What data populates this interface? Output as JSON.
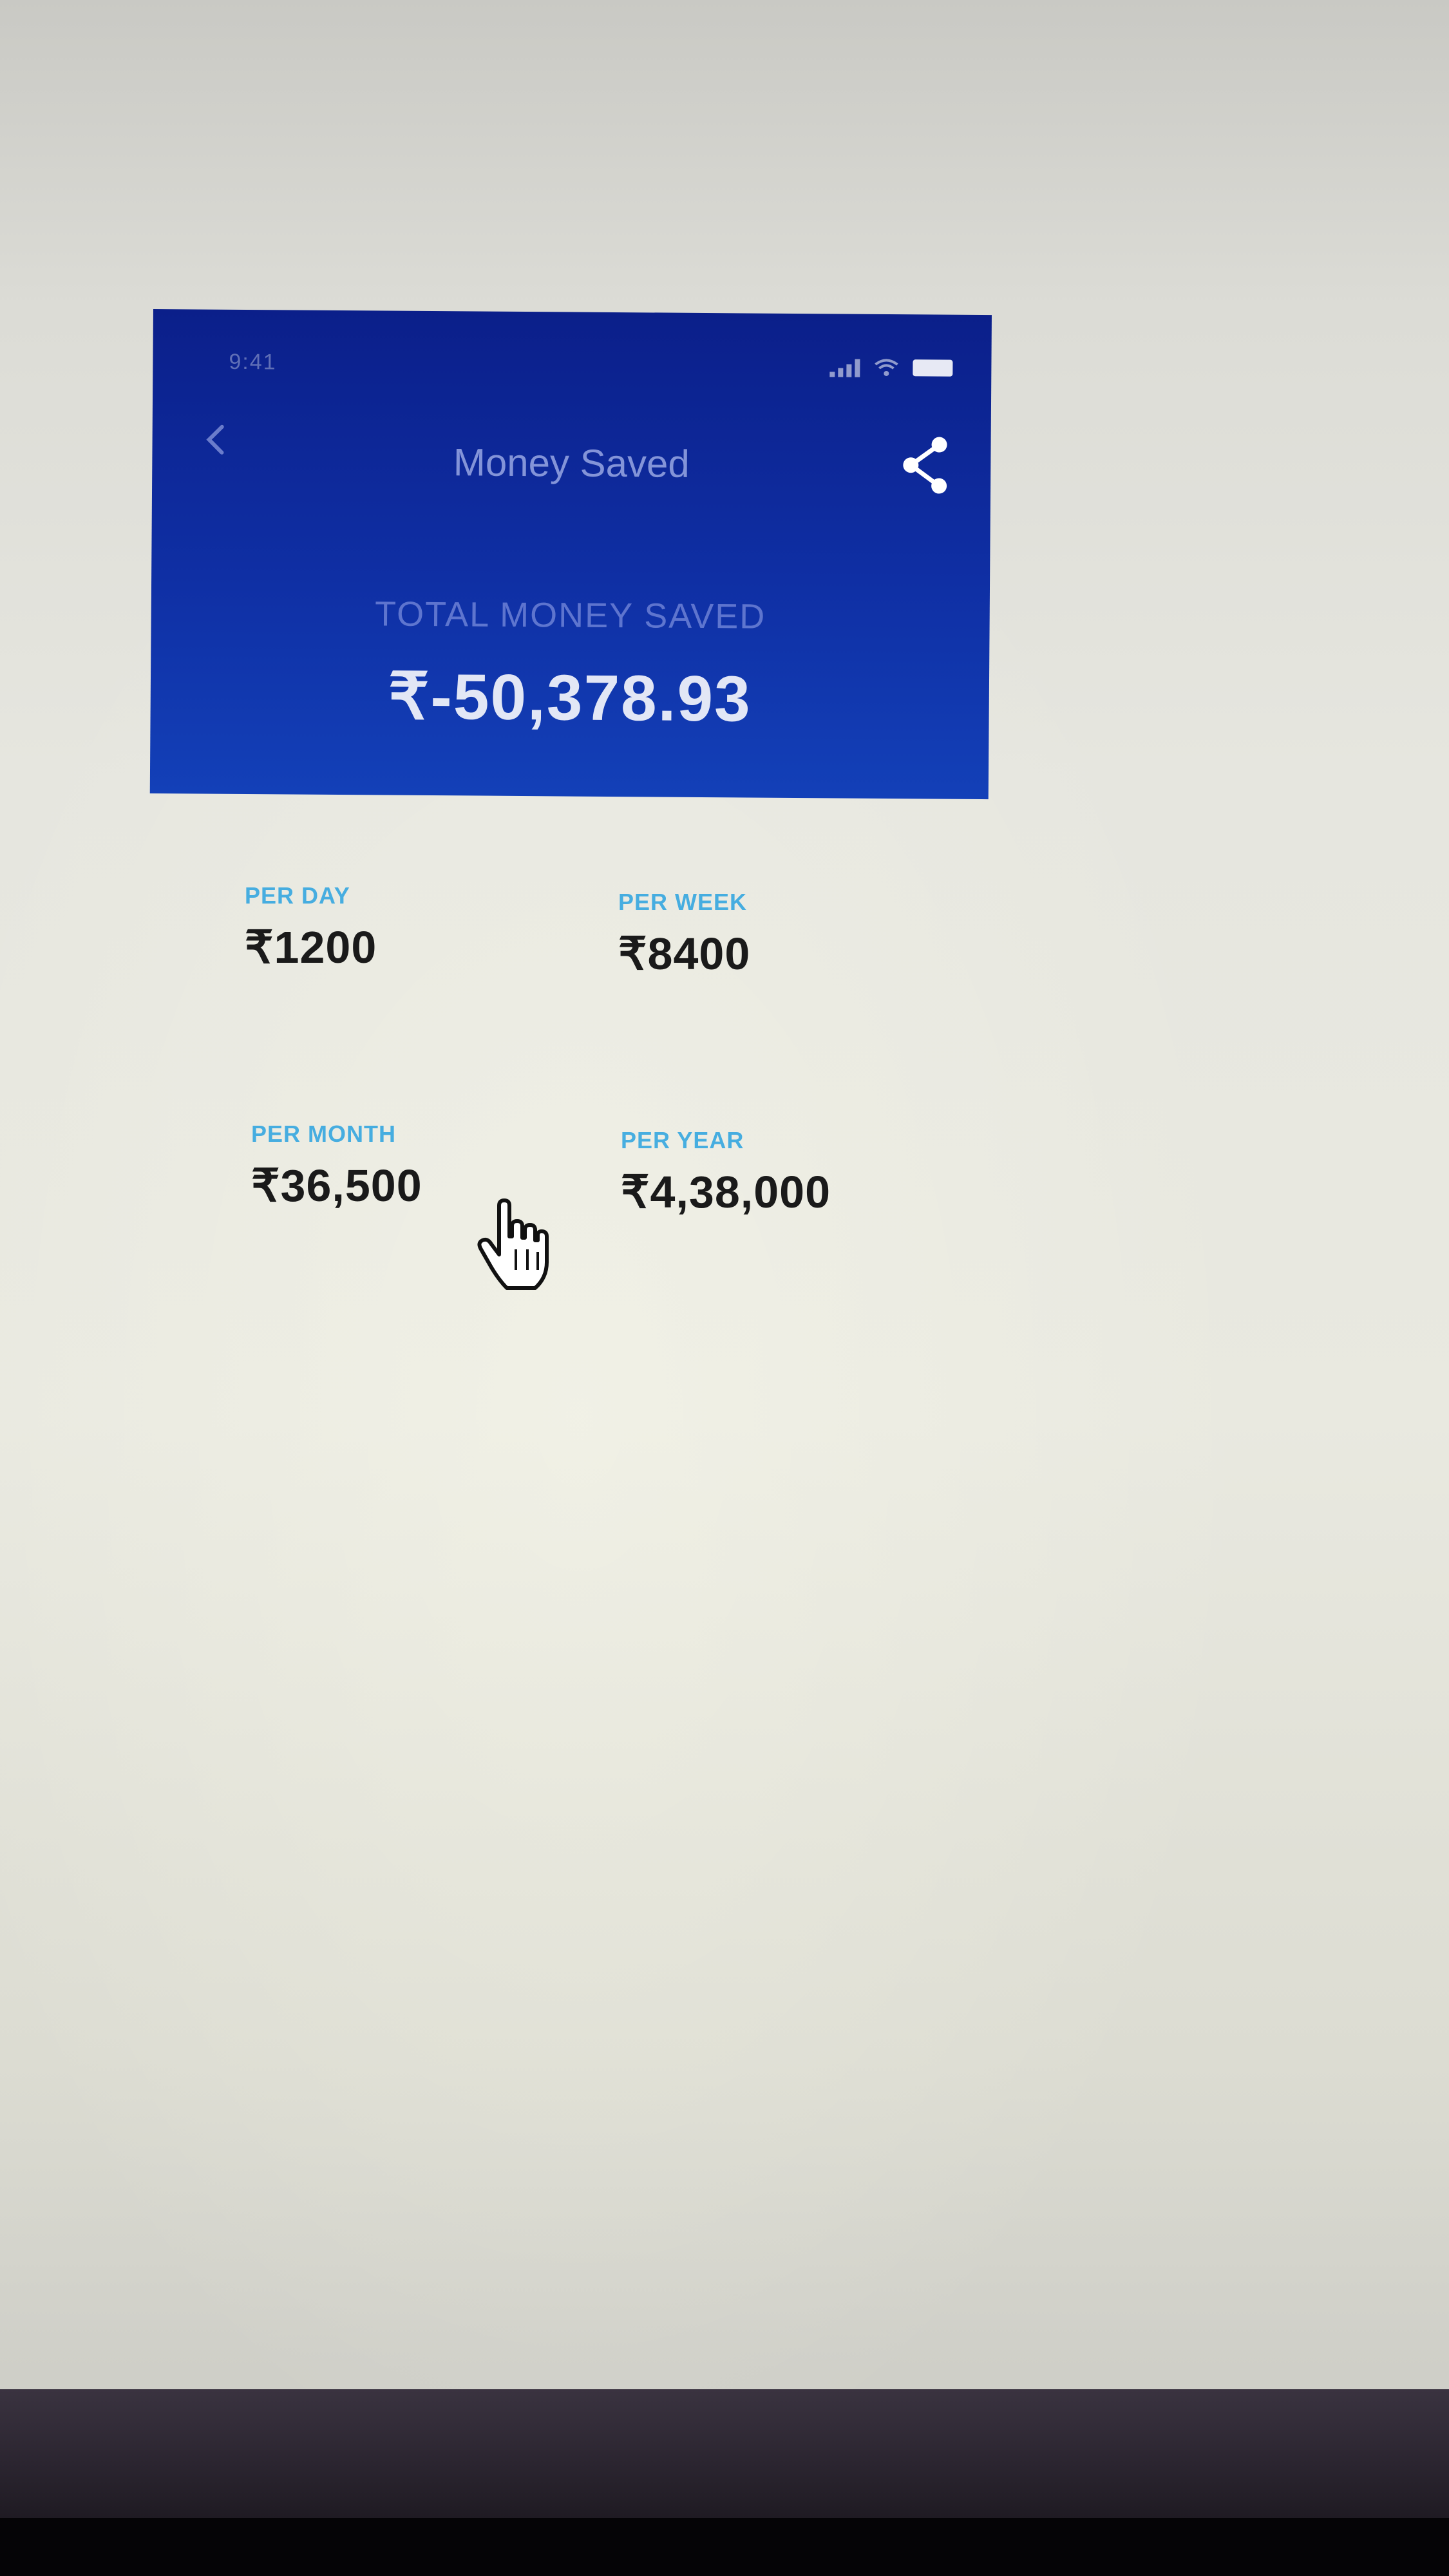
{
  "status_bar": {
    "time": "9:41",
    "icons": [
      "signal-icon",
      "wifi-icon",
      "battery-icon"
    ]
  },
  "nav": {
    "back_icon": "back-chevron-icon",
    "title": "Money Saved",
    "share_icon": "share-icon"
  },
  "summary": {
    "label": "TOTAL MONEY SAVED",
    "value": "₹-50,378.93"
  },
  "stats": [
    {
      "label": "PER DAY",
      "value": "₹1200"
    },
    {
      "label": "PER WEEK",
      "value": "₹8400"
    },
    {
      "label": "PER MONTH",
      "value": "₹36,500"
    },
    {
      "label": "PER YEAR",
      "value": "₹4,38,000"
    }
  ],
  "colors": {
    "header_top": "#0b1f8a",
    "header_bottom": "#1340b8",
    "label_blue": "#2aa3e0",
    "value_text": "#1a1a1a"
  },
  "cursor_icon": "hand-pointer-icon"
}
